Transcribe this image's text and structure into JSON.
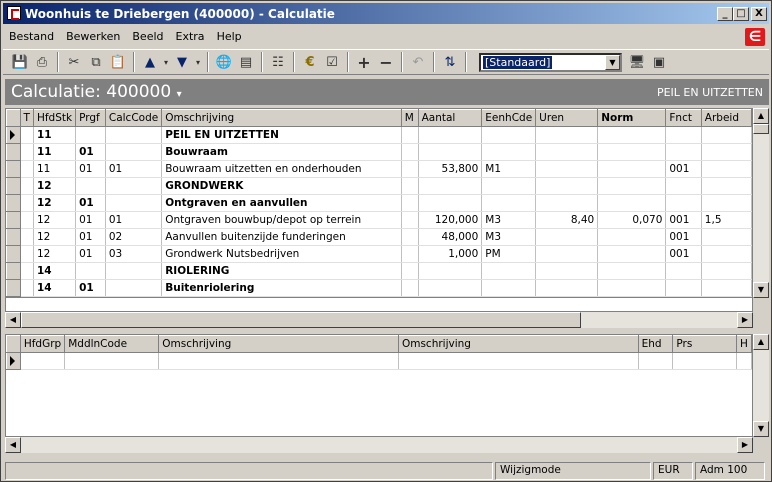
{
  "window": {
    "title": "Woonhuis te Driebergen (400000) - Calculatie",
    "min_label": "_",
    "max_label": "□",
    "close_label": "X"
  },
  "menubar": {
    "items": [
      "Bestand",
      "Bewerken",
      "Beeld",
      "Extra",
      "Help"
    ],
    "logo": "∈"
  },
  "toolbar": {
    "style_select_value": "[Standaard]"
  },
  "header": {
    "title": "Calculatie: 400000",
    "context": "PEIL EN UITZETTEN"
  },
  "main_grid": {
    "columns": [
      "T",
      "HfdStk",
      "Prgf",
      "CalcCode",
      "Omschrijving",
      "M",
      "Aantal",
      "EenhCde",
      "Uren",
      "Norm",
      "Fnct",
      "Arbeid"
    ],
    "rows": [
      {
        "bold": true,
        "cells": [
          "",
          "11",
          "",
          "",
          "PEIL EN UITZETTEN",
          "",
          "",
          "",
          "",
          "",
          "",
          ""
        ]
      },
      {
        "bold": true,
        "cells": [
          "",
          "11",
          "01",
          "",
          "Bouwraam",
          "",
          "",
          "",
          "",
          "",
          "",
          ""
        ]
      },
      {
        "bold": false,
        "cells": [
          "",
          "11",
          "01",
          "01",
          "Bouwraam uitzetten en onderhouden",
          "",
          "53,800",
          "M1",
          "",
          "",
          "001",
          ""
        ]
      },
      {
        "bold": true,
        "cells": [
          "",
          "12",
          "",
          "",
          "GRONDWERK",
          "",
          "",
          "",
          "",
          "",
          "",
          ""
        ]
      },
      {
        "bold": true,
        "cells": [
          "",
          "12",
          "01",
          "",
          "Ontgraven en aanvullen",
          "",
          "",
          "",
          "",
          "",
          "",
          ""
        ]
      },
      {
        "bold": false,
        "cells": [
          "",
          "12",
          "01",
          "01",
          "Ontgraven bouwbup/depot op terrein",
          "",
          "120,000",
          "M3",
          "8,40",
          "0,070",
          "001",
          "1,5"
        ]
      },
      {
        "bold": false,
        "cells": [
          "",
          "12",
          "01",
          "02",
          "Aanvullen buitenzijde funderingen",
          "",
          "48,000",
          "M3",
          "",
          "",
          "001",
          ""
        ]
      },
      {
        "bold": false,
        "cells": [
          "",
          "12",
          "01",
          "03",
          "Grondwerk Nutsbedrijven",
          "",
          "1,000",
          "PM",
          "",
          "",
          "001",
          ""
        ]
      },
      {
        "bold": true,
        "cells": [
          "",
          "14",
          "",
          "",
          "RIOLERING",
          "",
          "",
          "",
          "",
          "",
          "",
          ""
        ]
      },
      {
        "bold": true,
        "cells": [
          "",
          "14",
          "01",
          "",
          "Buitenriolering",
          "",
          "",
          "",
          "",
          "",
          "",
          ""
        ]
      }
    ]
  },
  "detail_grid": {
    "columns": [
      "HfdGrp",
      "MddlnCode",
      "Omschrijving",
      "Omschrijving",
      "Ehd",
      "Prs",
      "H"
    ]
  },
  "statusbar": {
    "mode": "Wijzigmode",
    "currency": "EUR",
    "admin": "Adm 100"
  }
}
